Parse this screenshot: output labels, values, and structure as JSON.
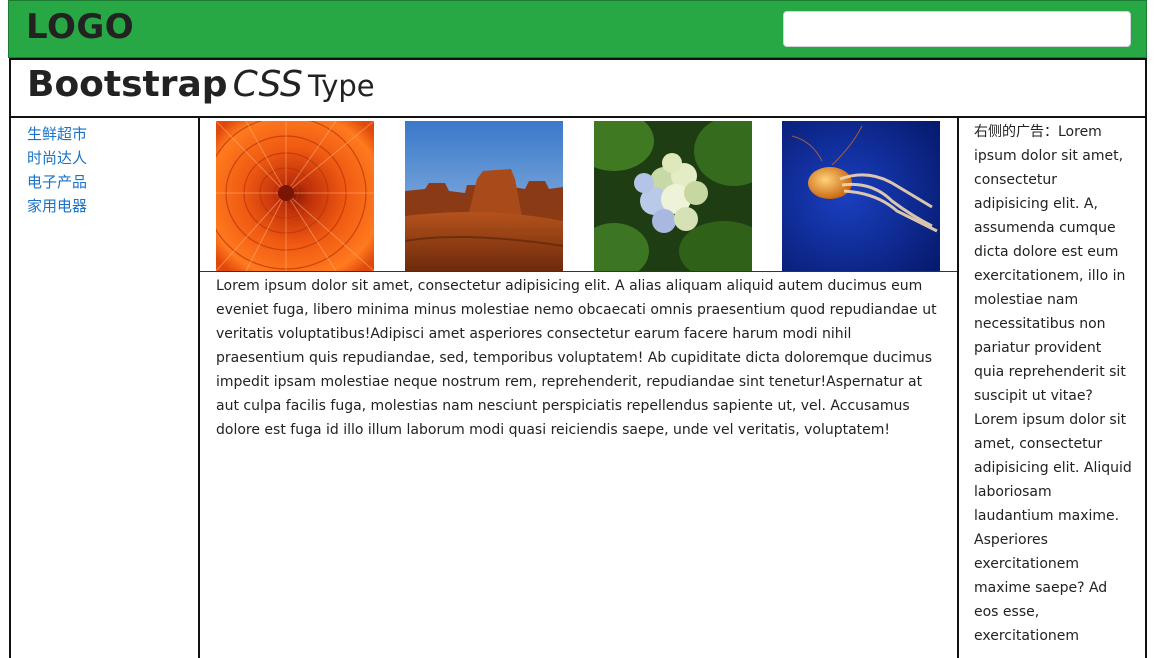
{
  "header": {
    "logo": "LOGO",
    "search_value": "",
    "search_placeholder": "",
    "brand_color": "#28a745"
  },
  "title": {
    "bold": "Bootstrap",
    "italic": "CSS",
    "small": "Type"
  },
  "nav": {
    "items": [
      {
        "label": "生鲜超市"
      },
      {
        "label": "时尚达人"
      },
      {
        "label": "电子产品"
      },
      {
        "label": "家用电器"
      }
    ],
    "link_color": "#1a73c7"
  },
  "gallery": {
    "images": [
      {
        "name": "orange-chrysanthemum"
      },
      {
        "name": "desert-butte"
      },
      {
        "name": "hydrangea"
      },
      {
        "name": "jellyfish"
      }
    ]
  },
  "article": {
    "text": "Lorem ipsum dolor sit amet, consectetur adipisicing elit. A alias aliquam aliquid autem ducimus eum eveniet fuga, libero minima minus molestiae nemo obcaecati omnis praesentium quod repudiandae ut veritatis voluptatibus!Adipisci amet asperiores consectetur earum facere harum modi nihil praesentium quis repudiandae, sed, temporibus voluptatem! Ab cupiditate dicta doloremque ducimus impedit ipsam molestiae neque nostrum rem, reprehenderit, repudiandae sint tenetur!Aspernatur at aut culpa facilis fuga, molestias nam nesciunt perspiciatis repellendus sapiente ut, vel. Accusamus dolore est fuga id illo illum laborum modi quasi reiciendis saepe, unde vel veritatis, voluptatem!"
  },
  "sidebar_ad": {
    "text": "右侧的广告：Lorem ipsum dolor sit amet, consectetur adipisicing elit. A, assumenda cumque dicta dolore est eum exercitationem, illo in molestiae nam necessitatibus non pariatur provident quia reprehenderit sit suscipit ut vitae? Lorem ipsum dolor sit amet, consectetur adipisicing elit. Aliquid laboriosam laudantium maxime. Asperiores exercitationem maxime saepe? Ad eos esse, exercitationem"
  }
}
